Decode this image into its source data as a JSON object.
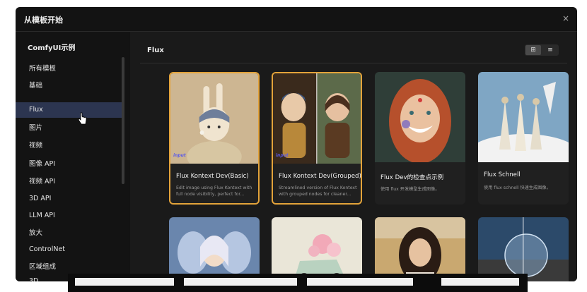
{
  "dialog": {
    "title": "从模板开始",
    "close_symbol": "×"
  },
  "sidebar": {
    "title": "ComfyUI示例",
    "items": [
      {
        "label": "所有模板"
      },
      {
        "label": "基础"
      },
      {
        "label": "Flux"
      },
      {
        "label": "图片"
      },
      {
        "label": "视频"
      },
      {
        "label": "图像 API"
      },
      {
        "label": "视频 API"
      },
      {
        "label": "3D API"
      },
      {
        "label": "LLM API"
      },
      {
        "label": "放大"
      },
      {
        "label": "ControlNet"
      },
      {
        "label": "区域组成"
      },
      {
        "label": "3D"
      }
    ],
    "active_index": 2
  },
  "main": {
    "title": "Flux",
    "view_grid_symbol": "⊞",
    "view_list_symbol": "≡"
  },
  "cards": [
    {
      "name": "Flux Kontext Dev(Basic)",
      "desc": "Edit image using Flux Kontext with full node visibility, perfect for...",
      "badge": "input",
      "selected": true
    },
    {
      "name": "Flux Kontext Dev(Grouped)",
      "desc": "Streamlined version of Flux Kontext with grouped nodes for cleaner...",
      "badge": "input",
      "selected": true
    },
    {
      "name": "Flux Dev的检查点示例",
      "desc": "使用 flux 开发模型生成图像。",
      "badge": "",
      "selected": false
    },
    {
      "name": "Flux Schnell",
      "desc": "使用 flux schnell 快速生成图像。",
      "badge": "",
      "selected": false
    }
  ],
  "colors": {
    "accent": "#e3a33a",
    "active_nav": "#2c3550",
    "badge": "#5a5ae8"
  }
}
